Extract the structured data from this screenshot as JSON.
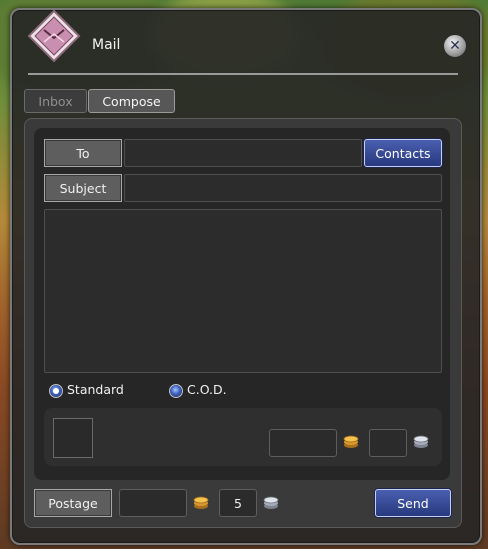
{
  "window": {
    "title": "Mail",
    "close_icon": "close-icon"
  },
  "tabs": [
    {
      "label": "Inbox",
      "active": false
    },
    {
      "label": "Compose",
      "active": true
    }
  ],
  "compose": {
    "to_label": "To",
    "to_value": "",
    "contacts_label": "Contacts",
    "subject_label": "Subject",
    "subject_value": "",
    "body_value": ""
  },
  "delivery": {
    "options": [
      {
        "label": "Standard",
        "selected": true
      },
      {
        "label": "C.O.D.",
        "selected": false
      }
    ]
  },
  "attachment": {
    "gold_value": "",
    "silver_value": ""
  },
  "footer": {
    "postage_label": "Postage",
    "postage_gold_value": "",
    "postage_silver_value": "5",
    "send_label": "Send"
  },
  "colors": {
    "accent": "#3c5fb8",
    "gold_coin": "#e2a93c",
    "silver_coin": "#b9bfcc"
  }
}
